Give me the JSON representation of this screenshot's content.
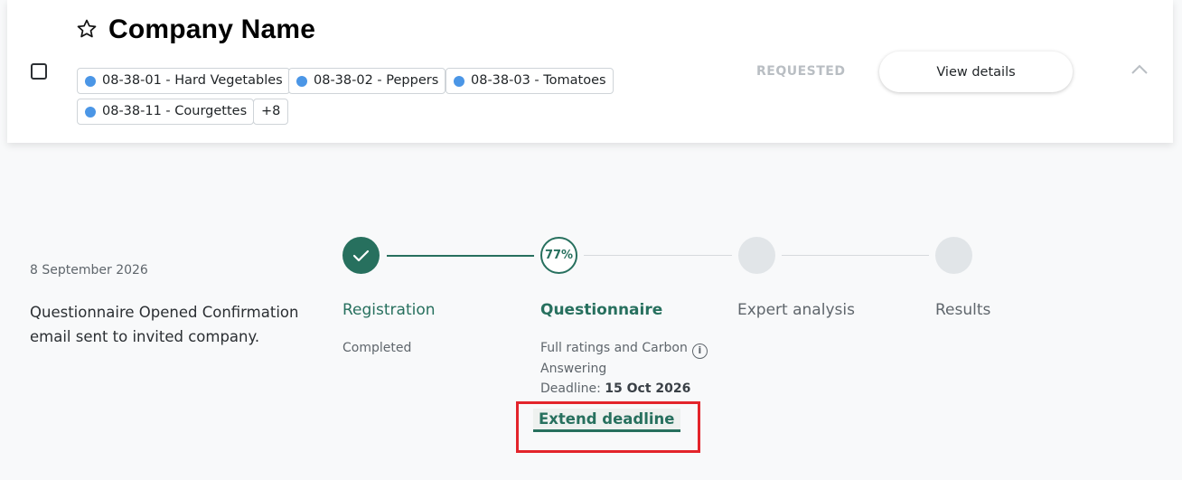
{
  "company": {
    "name": "Company Name"
  },
  "tags": [
    {
      "label": "08-38-01 - Hard Vegetables",
      "color": "#4b96e6"
    },
    {
      "label": "08-38-02 - Peppers",
      "color": "#4b96e6"
    },
    {
      "label": "08-38-03 - Tomatoes",
      "color": "#4b96e6"
    },
    {
      "label": "08-38-11 - Courgettes",
      "color": "#4b96e6"
    }
  ],
  "tags_more": "+8",
  "status": "REQUESTED",
  "view_details_label": "View details",
  "timeline": {
    "date": "8 September 2026",
    "event": "Questionnaire Opened Confirmation email sent to invited company."
  },
  "steps": [
    {
      "label": "Registration",
      "state": "completed",
      "sub": "Completed"
    },
    {
      "label": "Questionnaire",
      "state": "active",
      "progress": "77%",
      "sub_type": "Full ratings and Carbon",
      "sub_status": "Answering",
      "deadline_label": "Deadline:",
      "deadline_value": "15 Oct 2026"
    },
    {
      "label": "Expert analysis",
      "state": "pending"
    },
    {
      "label": "Results",
      "state": "pending"
    }
  ],
  "extend_deadline_label": "Extend deadline",
  "colors": {
    "primary": "#27705e",
    "tag_dot": "#4b96e6",
    "highlight": "#e3242b"
  }
}
